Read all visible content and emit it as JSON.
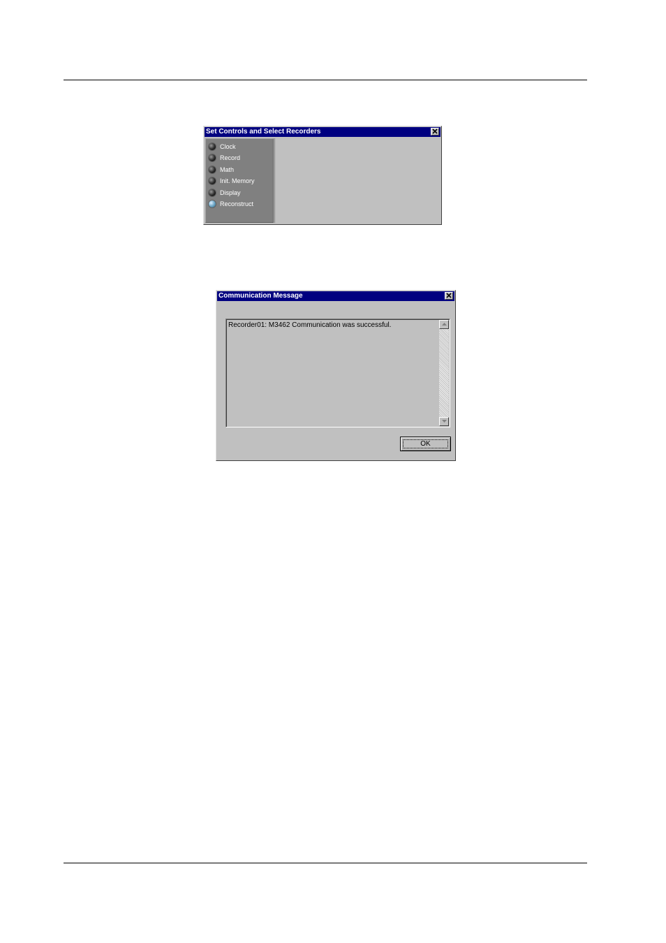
{
  "set_controls_window": {
    "title": "Set Controls and Select Recorders",
    "menu_items": [
      {
        "label": "Clock",
        "selected": false
      },
      {
        "label": "Record",
        "selected": false
      },
      {
        "label": "Math",
        "selected": false
      },
      {
        "label": "Init. Memory",
        "selected": false
      },
      {
        "label": "Display",
        "selected": false
      },
      {
        "label": "Reconstruct",
        "selected": true
      }
    ]
  },
  "communication_window": {
    "title": "Communication Message",
    "message": "Recorder01: M3462 Communication was successful.",
    "ok_label": "OK"
  },
  "colors": {
    "titlebar": "#000080",
    "window_face": "#c0c0c0",
    "sidebar": "#808080"
  }
}
